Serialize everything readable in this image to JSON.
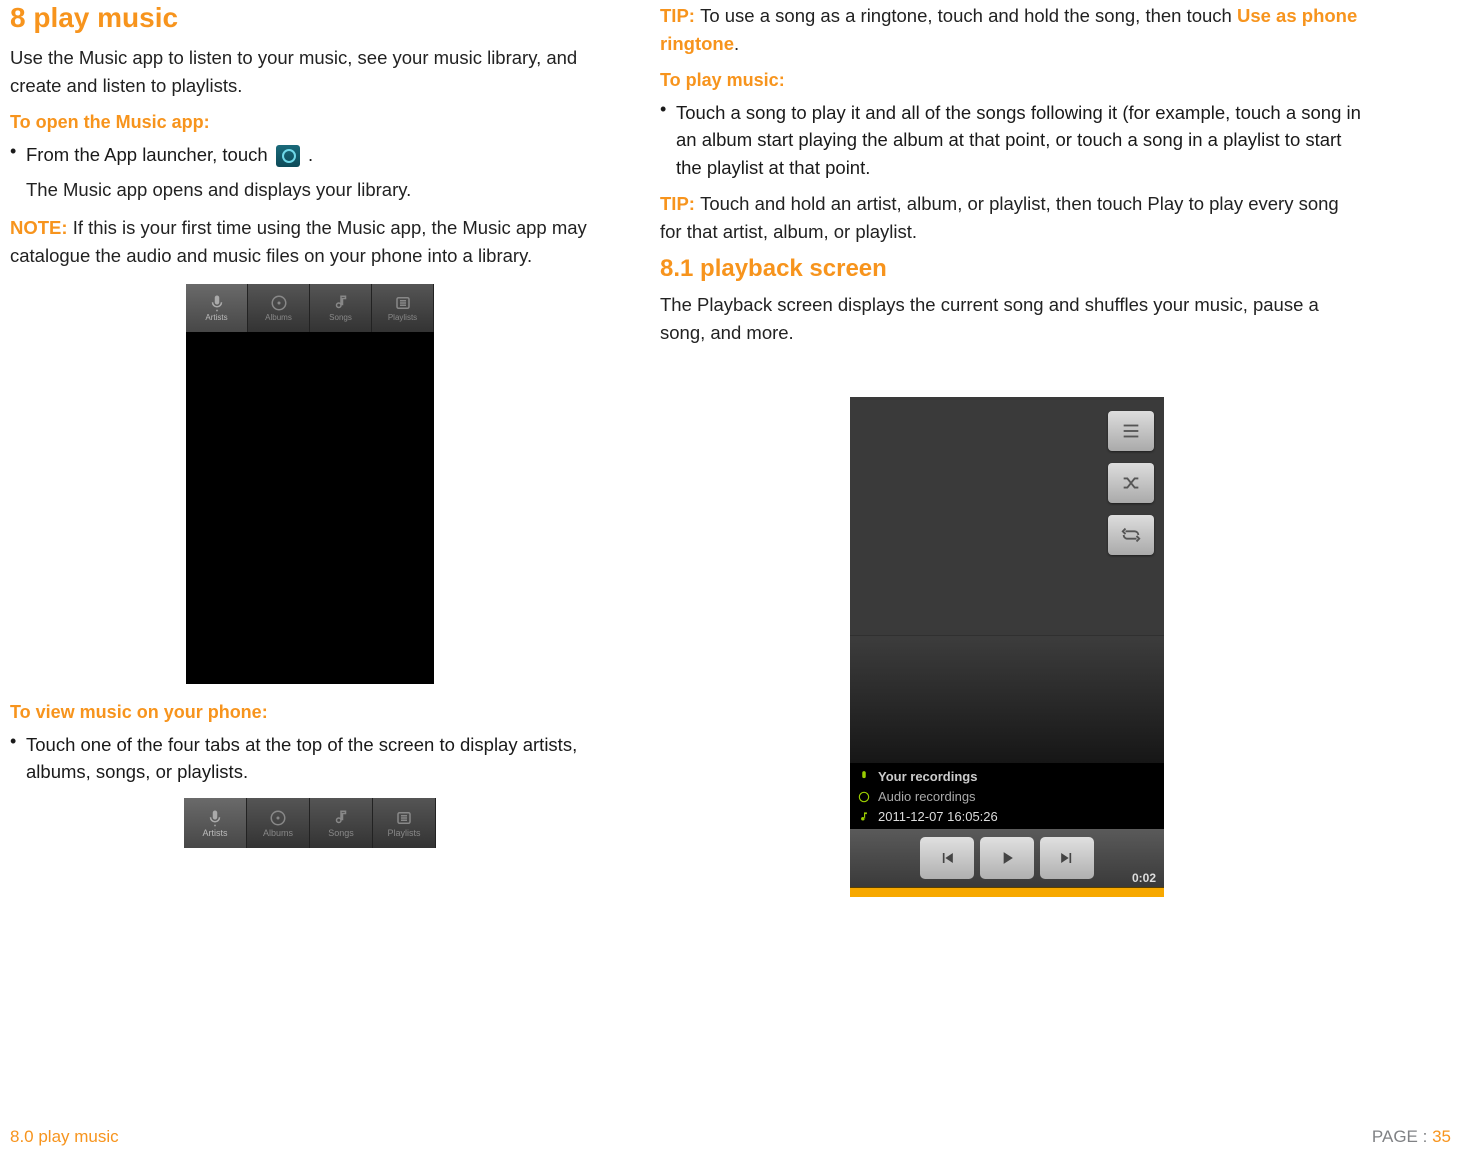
{
  "left": {
    "h1": "8 play music",
    "intro": "Use the Music app to listen to your music, see your music library, and create and listen to playlists.",
    "openSub": "To open the Music app:",
    "openBullet_pre": "From the App launcher, touch ",
    "openBullet_post": " .",
    "openResult": "The Music app opens and displays your library.",
    "noteLabel": "NOTE: ",
    "noteText": "If this is your first time using the Music app, the Music app may catalogue the audio and music files on your phone into a library.",
    "viewSub": "To view music on your phone:",
    "viewBullet": "Touch one of the four tabs at the top of the screen to display artists, albums, songs, or playlists.",
    "tabs": [
      "Artists",
      "Albums",
      "Songs",
      "Playlists"
    ]
  },
  "right": {
    "tipLabel": "TIP: ",
    "tip1_pre": "To use a song as a ringtone, touch and hold the song, then touch ",
    "tip1_link": "Use as phone ringtone",
    "tip1_post": ".",
    "playSub": "To play music:",
    "playBullet": "Touch a song to play it and all of the songs following it (for example, touch a song in an album start playing the album at that point, or touch a song in a playlist to start the playlist at that point.",
    "tip2Label": "TIP: ",
    "tip2Text": "Touch and hold an artist, album, or playlist, then touch Play to play every song for that artist, album, or playlist.",
    "h2": "8.1 playback screen",
    "h2desc": "The Playback screen displays the current song and shuffles your music, pause a song, and more.",
    "meta1": "Your recordings",
    "meta2": "Audio recordings",
    "meta3": "2011-12-07 16:05:26",
    "timecode": "0:02"
  },
  "footer": {
    "left": "8.0 play music",
    "pageLabel": "PAGE : ",
    "pageNum": "35"
  }
}
